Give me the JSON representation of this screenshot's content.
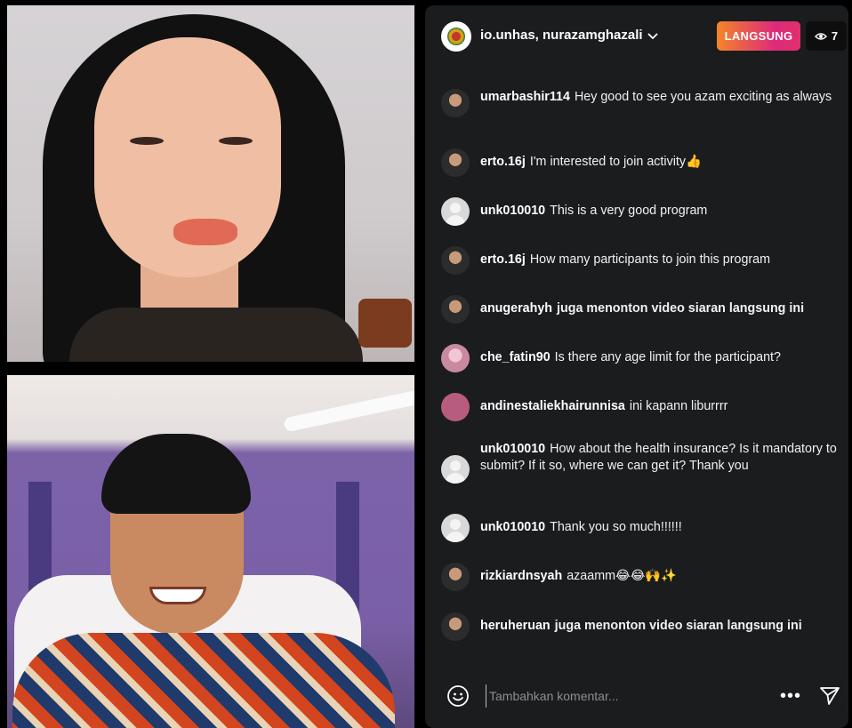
{
  "header": {
    "host_names": "io.unhas, nurazamghazali",
    "live_label": "LANGSUNG",
    "viewer_count": "7"
  },
  "comments": [
    {
      "user": "umarbashir114",
      "text": "Hey good to see you azam exciting as always",
      "avatar": "photo"
    },
    {
      "user": "erto.16j",
      "text": "I'm interested to join activity👍",
      "avatar": "photo"
    },
    {
      "user": "unk010010",
      "text": "This is a very good program",
      "avatar": "default"
    },
    {
      "user": "erto.16j",
      "text": "How many participants to join this program",
      "avatar": "photo"
    },
    {
      "user": "anugerahyh",
      "text": "juga menonton video siaran langsung ini",
      "avatar": "photo"
    },
    {
      "user": "che_fatin90",
      "text": "Is there any age limit for the participant?",
      "avatar": "pink"
    },
    {
      "user": "andinestaliekhairunnisa",
      "text": "ini kapann liburrrr",
      "avatar": "magenta"
    },
    {
      "user": "unk010010",
      "text": "How about the health insurance? Is it mandatory to submit? If it so, where we can get it? Thank you",
      "avatar": "default"
    },
    {
      "user": "unk010010",
      "text": "Thank you so much!!!!!!",
      "avatar": "default"
    },
    {
      "user": "rizkiardnsyah",
      "text": "azaamm😂😂🙌✨",
      "avatar": "photo"
    },
    {
      "user": "heruheruan",
      "text": "juga menonton video siaran langsung ini",
      "avatar": "photo"
    }
  ],
  "composer": {
    "placeholder": "Tambahkan komentar...",
    "more_label": "•••"
  },
  "icons": {
    "viewers": "eye-icon",
    "emoji": "smiley-icon",
    "send": "paper-plane-icon",
    "dropdown": "chevron-down-icon"
  },
  "colors": {
    "live_gradient_start": "#f58529",
    "live_gradient_end": "#e1306c",
    "panel_bg": "#1b1c1e"
  }
}
